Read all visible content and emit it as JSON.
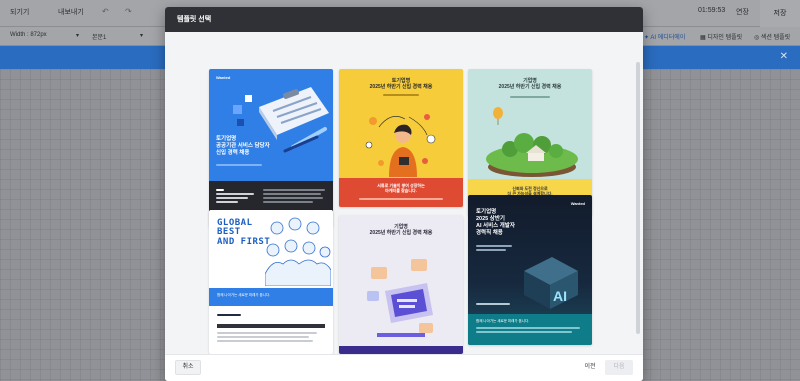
{
  "toolbar": {
    "prev_label": "되기기",
    "export_label": "내보내기",
    "undo_icon": "undo-icon",
    "redo_icon": "redo-icon",
    "timer": "01:59:53",
    "extend_label": "연장",
    "save_label": "저장"
  },
  "subbar": {
    "width_label": "Width : 872px",
    "style_label": "본문1",
    "ai_label": "AI 에디터에이",
    "design_label": "디자인 템플릿",
    "section_label": "섹션 템플릿"
  },
  "modal": {
    "title": "템플릿 선택",
    "cancel_label": "취소",
    "prev_label": "이전",
    "next_label": "다음"
  },
  "templates": [
    {
      "title": "토기업명\n공공기관 서비스 담당자\n신입 경력 채용",
      "logo": "Wanted"
    },
    {
      "title": "토기업명\n2025년 하반기 신입 경력 채용",
      "bottom": "서류로 기술이 쌓여 성장하는\n마케터를 찾습니다."
    },
    {
      "title": "기업명\n2025년 하반기 신입 경력 채용",
      "bottom": "신뢰와 도전 정신으로\n더 큰 가능성을 설계합니다."
    },
    {
      "title": "GLOBAL\nBEST\nAND FIRST",
      "band": "함께 나아가는 새로운 미래가 옵니다."
    },
    {
      "title": "기업명\n2025년 하반기 신입 경력 채용"
    },
    {
      "title": "토기업명\n2025 상반기\nAI 서비스 개발자\n경력직 채용",
      "bottom": "함께 나아가는 새로운 미래가 옵니다.",
      "logo": "Wanted"
    }
  ],
  "colors": {
    "accent": "#2a6cbf",
    "modal_header": "#2f3136"
  }
}
